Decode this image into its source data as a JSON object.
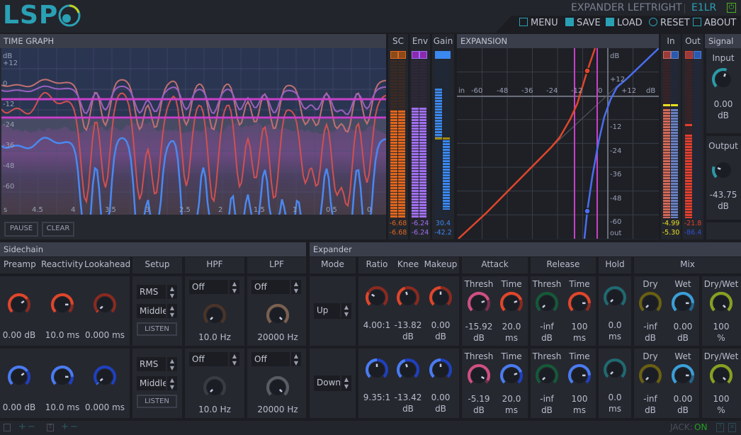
{
  "header": {
    "logo": "LSP",
    "title": "EXPANDER LEFTRIGHT",
    "code": "E1LR",
    "menu": [
      {
        "label": "MENU",
        "icon": "menu-icon"
      },
      {
        "label": "SAVE",
        "icon": "save-icon"
      },
      {
        "label": "LOAD",
        "icon": "load-icon"
      },
      {
        "label": "RESET",
        "icon": "reset-icon"
      },
      {
        "label": "ABOUT",
        "icon": "about-icon"
      }
    ],
    "accent": "#2aa0b5",
    "power_color": "#4caf22"
  },
  "time_graph": {
    "title": "TIME GRAPH",
    "y_labels": [
      "dB",
      "+12",
      "0",
      "-12",
      "-24",
      "-36",
      "-48",
      "-60"
    ],
    "x_labels": [
      "s",
      "4.5",
      "4",
      "3.5",
      "3",
      "2.5",
      "2",
      "1.5",
      "1",
      "0.5",
      "0"
    ],
    "pause": "PAUSE",
    "clear": "CLEAR"
  },
  "meters": {
    "sc": {
      "label": "SC",
      "values": [
        "-6.68",
        "-6.68"
      ],
      "levels": [
        0.68,
        0.68
      ],
      "color": "#e0661e"
    },
    "env": {
      "label": "Env",
      "values": [
        "-6.24",
        "-6.24"
      ],
      "levels": [
        0.7,
        0.7
      ],
      "color": "#a070f0"
    },
    "gain": {
      "label": "Gain",
      "values": [
        "30.4",
        "-42.2"
      ],
      "color": "#3a88f0",
      "marker_color": "#a08a10"
    },
    "in": {
      "label": "In",
      "values": [
        "-4.99",
        "-5.30"
      ],
      "levels": [
        0.69,
        0.69
      ],
      "colors": [
        "#d06a58",
        "#6a80c0"
      ],
      "value_color": "#e8e020"
    },
    "out": {
      "label": "Out",
      "values": [
        "-21.8",
        "-86.4"
      ],
      "levels": [
        0.53,
        0.0
      ],
      "colors": [
        "#e04030",
        "#3040a0"
      ],
      "value_colors": [
        "#e04030",
        "#3050d0"
      ]
    }
  },
  "expansion": {
    "title": "EXPANSION",
    "in_labels": [
      "in",
      "-60",
      "-48",
      "-36",
      "-24",
      "-12",
      "0",
      "+12",
      "dB"
    ],
    "out_labels": [
      "dB",
      "+12",
      "-12",
      "-24",
      "-36",
      "-48",
      "-60",
      "out"
    ]
  },
  "signal": {
    "title": "Signal",
    "input": {
      "label": "Input",
      "value": "0.00",
      "unit": "dB",
      "level": 0.57,
      "color": "#2a9aa8"
    },
    "output": {
      "label": "Output",
      "value": "-43.75",
      "unit": "dB",
      "level": 0.24,
      "color": "#2a9aa8"
    }
  },
  "sidechain": {
    "title": "Sidechain",
    "headers": {
      "preamp": "Preamp",
      "reactivity": "Reactivity",
      "lookahead": "Lookahead",
      "setup": "Setup",
      "hpf": "HPF",
      "lpf": "LPF"
    },
    "listen": "LISTEN",
    "rows": [
      {
        "preamp": {
          "value": "0.00 dB",
          "level": 0.7,
          "color": "#e0462a",
          "dim": "#8a2a1f"
        },
        "reactivity": {
          "value": "10.0 ms",
          "level": 0.83,
          "color": "#e0462a",
          "dim": "#8a2a1f"
        },
        "lookahead": {
          "value": "0.000 ms",
          "level": 0.02,
          "color": "#e0462a",
          "dim": "#8a2a1f"
        },
        "mode": "RMS",
        "source": "Middle",
        "hpf": {
          "mode": "Off",
          "value": "10.0 Hz",
          "level": 0.0,
          "color": "#5a4030",
          "dim": "#4a3428"
        },
        "lpf": {
          "mode": "Off",
          "value": "20000 Hz",
          "level": 1.0,
          "color": "#7a6050",
          "dim": "#7a6050"
        }
      },
      {
        "preamp": {
          "value": "0.00 dB",
          "level": 0.7,
          "color": "#4a7cf0",
          "dim": "#1e40c0"
        },
        "reactivity": {
          "value": "10.0 ms",
          "level": 0.83,
          "color": "#4a7cf0",
          "dim": "#1e40c0"
        },
        "lookahead": {
          "value": "0.000 ms",
          "level": 0.02,
          "color": "#4a7cf0",
          "dim": "#1e40c0"
        },
        "mode": "RMS",
        "source": "Middle",
        "hpf": {
          "mode": "Off",
          "value": "10.0 Hz",
          "level": 0.0,
          "color": "#3a3c44",
          "dim": "#3a3c44"
        },
        "lpf": {
          "mode": "Off",
          "value": "20000 Hz",
          "level": 1.0,
          "color": "#5a5c64",
          "dim": "#5a5c64"
        }
      }
    ]
  },
  "expander": {
    "title": "Expander",
    "headers": {
      "mode": "Mode",
      "ratio": "Ratio",
      "knee": "Knee",
      "makeup": "Makeup",
      "attack": "Attack",
      "release": "Release",
      "hold": "Hold",
      "mix": "Mix"
    },
    "sub": {
      "thresh": "Thresh",
      "time": "Time",
      "dry": "Dry",
      "wet": "Wet",
      "drywet": "Dry/Wet"
    },
    "rows": [
      {
        "mode": "Up",
        "ratio": {
          "value": "4.00:1",
          "level": 0.28,
          "color": "#e0462a",
          "dim": "#8a2a1f"
        },
        "knee": {
          "value": "-13.82",
          "unit": "dB",
          "level": 0.43,
          "color": "#e0462a",
          "dim": "#8a2a1f"
        },
        "makeup": {
          "value": "0.00",
          "unit": "dB",
          "level": 0.5,
          "color": "#e0462a",
          "dim": "#8a2a1f"
        },
        "attack_thresh": {
          "value": "-15.92",
          "unit": "dB",
          "level": 0.76,
          "color": "#d05080",
          "dim": "#7a3050"
        },
        "attack_time": {
          "value": "20.0",
          "unit": "ms",
          "level": 0.76,
          "color": "#e0462a",
          "dim": "#8a2a1f"
        },
        "release_thresh": {
          "value": "-inf",
          "unit": "dB",
          "level": 0.0,
          "color": "#1a7a4a",
          "dim": "#145a38"
        },
        "release_time": {
          "value": "100",
          "unit": "ms",
          "level": 0.83,
          "color": "#e0462a",
          "dim": "#8a2a1f"
        },
        "hold": {
          "value": "0.0",
          "unit": "ms",
          "level": 0.0,
          "color": "#1f6a70",
          "dim": "#1f6a70"
        },
        "dry": {
          "value": "-inf",
          "unit": "dB",
          "level": 0.0,
          "color": "#6a6010",
          "dim": "#6a6010"
        },
        "wet": {
          "value": "0.00",
          "unit": "dB",
          "level": 0.83,
          "color": "#3aa0d8",
          "dim": "#22648a"
        },
        "drywet": {
          "value": "100",
          "unit": "%",
          "level": 1.0,
          "color": "#88a020",
          "dim": "#88a020"
        }
      },
      {
        "mode": "Down",
        "ratio": {
          "value": "9.35:1",
          "level": 0.5,
          "color": "#4a7cf0",
          "dim": "#1e40c0"
        },
        "knee": {
          "value": "-13.42",
          "unit": "dB",
          "level": 0.43,
          "color": "#4a7cf0",
          "dim": "#1e40c0"
        },
        "makeup": {
          "value": "0.00",
          "unit": "dB",
          "level": 0.5,
          "color": "#4a7cf0",
          "dim": "#1e40c0"
        },
        "attack_thresh": {
          "value": "-5.19",
          "unit": "dB",
          "level": 0.94,
          "color": "#d05080",
          "dim": "#7a3050"
        },
        "attack_time": {
          "value": "20.0",
          "unit": "ms",
          "level": 0.76,
          "color": "#4a7cf0",
          "dim": "#1e40c0"
        },
        "release_thresh": {
          "value": "-inf",
          "unit": "dB",
          "level": 0.0,
          "color": "#1a7a4a",
          "dim": "#145a38"
        },
        "release_time": {
          "value": "100",
          "unit": "ms",
          "level": 0.83,
          "color": "#4a7cf0",
          "dim": "#1e40c0"
        },
        "hold": {
          "value": "0.0",
          "unit": "ms",
          "level": 0.0,
          "color": "#1f6a70",
          "dim": "#1f6a70"
        },
        "dry": {
          "value": "-inf",
          "unit": "dB",
          "level": 0.0,
          "color": "#6a6010",
          "dim": "#6a6010"
        },
        "wet": {
          "value": "0.00",
          "unit": "dB",
          "level": 0.83,
          "color": "#3aa0d8",
          "dim": "#22648a"
        },
        "drywet": {
          "value": "100",
          "unit": "%",
          "level": 1.0,
          "color": "#88a020",
          "dim": "#88a020"
        }
      }
    ]
  },
  "footer": {
    "jack_label": "JACK:",
    "jack_state": "ON",
    "jack_color": "#22a022"
  }
}
